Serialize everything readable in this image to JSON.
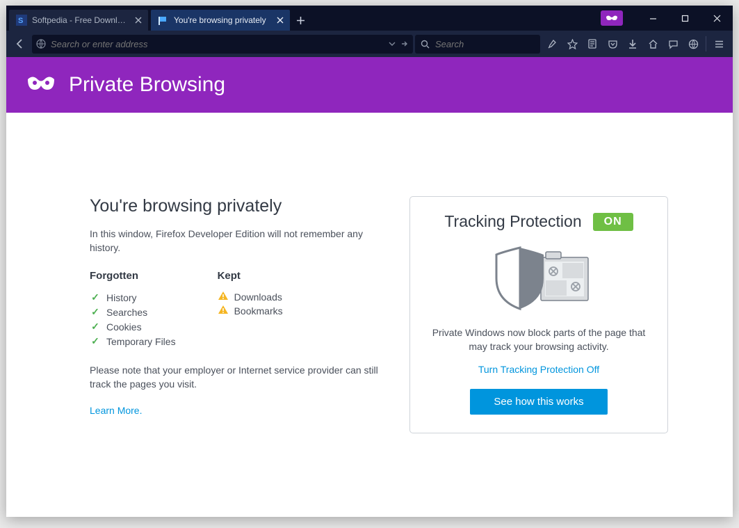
{
  "tabs": [
    {
      "label": "Softpedia - Free Downloa..."
    },
    {
      "label": "You're browsing privately"
    }
  ],
  "urlbar": {
    "placeholder": "Search or enter address"
  },
  "searchbar": {
    "placeholder": "Search"
  },
  "header": {
    "title": "Private Browsing"
  },
  "main": {
    "heading": "You're browsing privately",
    "subtext": "In this window, Firefox Developer Edition will not remember any history.",
    "forgotten_label": "Forgotten",
    "kept_label": "Kept",
    "forgotten": [
      "History",
      "Searches",
      "Cookies",
      "Temporary Files"
    ],
    "kept": [
      "Downloads",
      "Bookmarks"
    ],
    "note": "Please note that your employer or Internet service provider can still track the pages you visit.",
    "learn_more": "Learn More."
  },
  "tracking": {
    "heading": "Tracking Protection",
    "badge": "ON",
    "desc": "Private Windows now block parts of the page that may track your browsing activity.",
    "toggle_link": "Turn Tracking Protection Off",
    "see_how": "See how this works"
  }
}
